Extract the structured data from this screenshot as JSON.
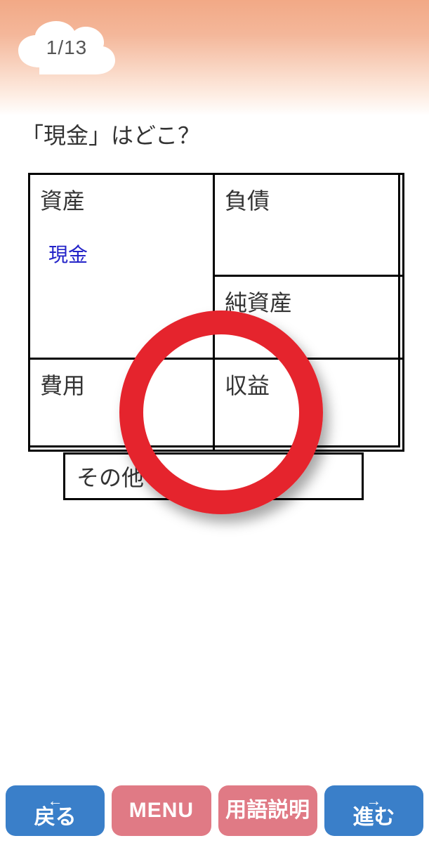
{
  "progress": "1/13",
  "question": "「現金」はどこ？",
  "cells": {
    "assets": "資産",
    "assets_sub": "現金",
    "liabilities": "負債",
    "net_assets": "純資産",
    "expenses": "費用",
    "revenues": "収益"
  },
  "other": "その他",
  "bottom": {
    "back_arrow": "←",
    "back": "戻る",
    "menu": "MENU",
    "glossary": "用語説明",
    "next_arrow": "→",
    "next": "進む"
  }
}
